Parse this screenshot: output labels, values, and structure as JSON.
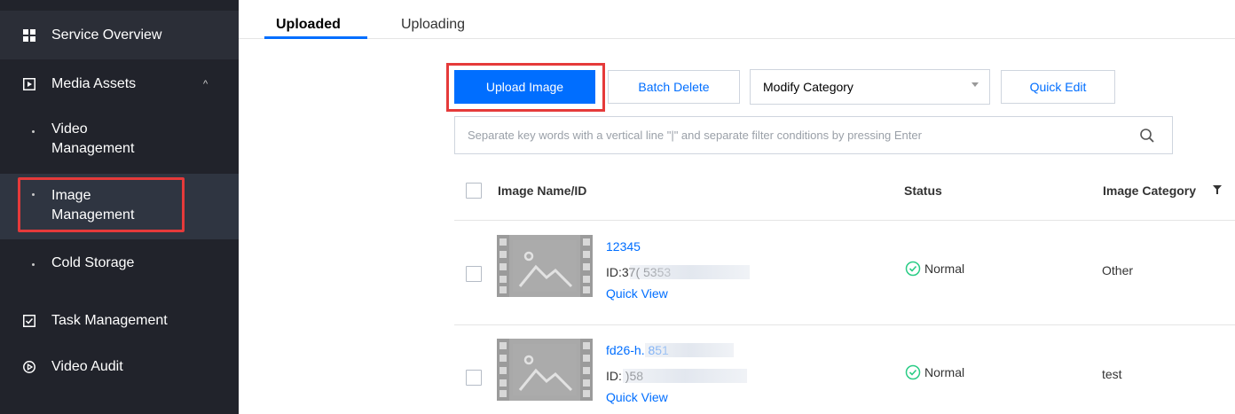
{
  "sidebar": {
    "items": [
      {
        "label": "Service Overview",
        "icon": "grid-icon"
      },
      {
        "label": "Media Assets",
        "icon": "media-icon",
        "expanded": true
      },
      {
        "label": "Task Management",
        "icon": "task-icon"
      },
      {
        "label": "Video Audit",
        "icon": "audit-icon"
      }
    ],
    "sub_items": [
      {
        "label_line1": "Video",
        "label_line2": "Management"
      },
      {
        "label_line1": "Image",
        "label_line2": "Management",
        "active": true
      },
      {
        "label": "Cold Storage"
      }
    ]
  },
  "tabs": [
    {
      "label": "Uploaded",
      "active": true
    },
    {
      "label": "Uploading",
      "active": false
    }
  ],
  "toolbar": {
    "upload_label": "Upload Image",
    "batch_delete_label": "Batch Delete",
    "category_select_value": "Modify Category",
    "quick_edit_label": "Quick Edit"
  },
  "search": {
    "placeholder": "Separate key words with a vertical line \"|\" and separate filter conditions by pressing Enter"
  },
  "table": {
    "headers": {
      "name": "Image Name/ID",
      "status": "Status",
      "category": "Image Category"
    },
    "rows": [
      {
        "name": "12345",
        "id": "ID:37(      5353",
        "quick_view": "Quick View",
        "status": "Normal",
        "category": "Other"
      },
      {
        "name": "fd26-h.       851",
        "id": "ID:       )58",
        "quick_view": "Quick View",
        "status": "Normal",
        "category": "test"
      }
    ]
  },
  "colors": {
    "accent": "#006eff",
    "sidebar_bg": "#21232b",
    "highlight": "#e53a3a",
    "status_ok": "#29cc85"
  }
}
